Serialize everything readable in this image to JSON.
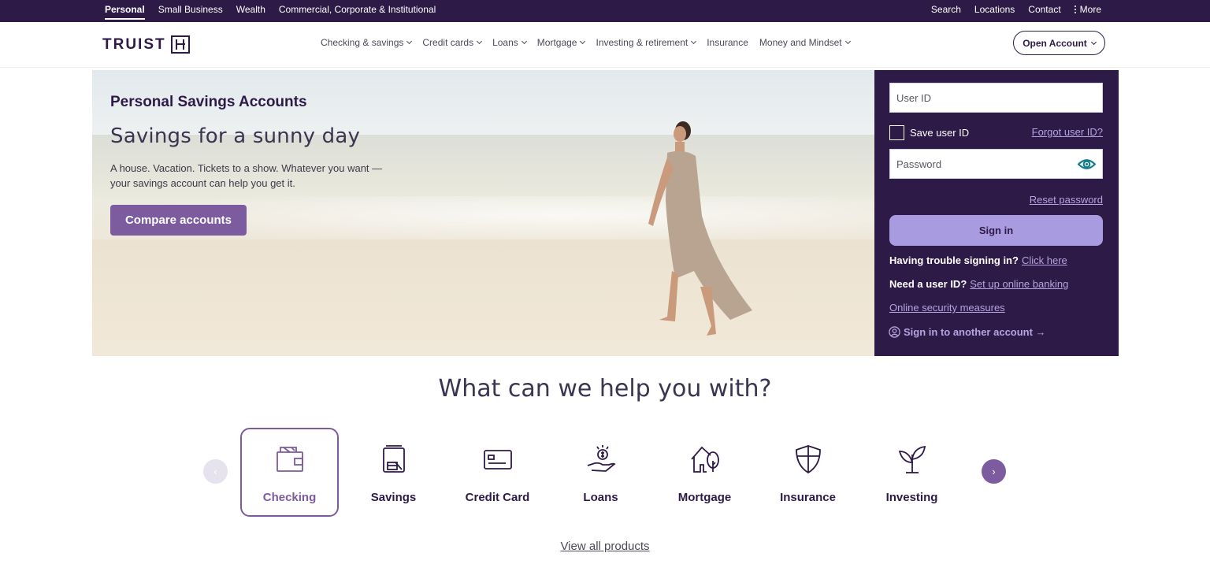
{
  "utility_nav": {
    "left": [
      "Personal",
      "Small Business",
      "Wealth",
      "Commercial, Corporate & Institutional"
    ],
    "right": {
      "search": "Search",
      "locations": "Locations",
      "contact": "Contact",
      "more": "More"
    }
  },
  "header": {
    "logo_text": "TRUIST",
    "nav": [
      "Checking & savings",
      "Credit cards",
      "Loans",
      "Mortgage",
      "Investing & retirement",
      "Insurance",
      "Money and Mindset"
    ],
    "open_account": "Open Account"
  },
  "hero": {
    "eyebrow": "Personal Savings Accounts",
    "title": "Savings for a sunny day",
    "body": "A house. Vacation. Tickets to a show. Whatever you want —your savings account can help you get it.",
    "cta": "Compare accounts"
  },
  "login": {
    "user_id_placeholder": "User ID",
    "save_user_id": "Save user ID",
    "forgot_user_id": "Forgot user ID?",
    "password_placeholder": "Password",
    "reset_password": "Reset password",
    "sign_in": "Sign in",
    "trouble_label": "Having trouble signing in?",
    "trouble_link": "Click here",
    "need_id_label": "Need a user ID?",
    "need_id_link": "Set up online banking",
    "security_link": "Online security measures",
    "another_account": "Sign in to another account →"
  },
  "help": {
    "title": "What can we help you with?",
    "prev_arrow": "‹",
    "next_arrow": "›",
    "products": [
      {
        "label": "Checking",
        "icon": "wallet-icon"
      },
      {
        "label": "Savings",
        "icon": "savings-jar-icon"
      },
      {
        "label": "Credit Card",
        "icon": "credit-card-icon"
      },
      {
        "label": "Loans",
        "icon": "hand-dollar-icon"
      },
      {
        "label": "Mortgage",
        "icon": "house-tree-icon"
      },
      {
        "label": "Insurance",
        "icon": "shield-icon"
      },
      {
        "label": "Investing",
        "icon": "sprout-icon"
      }
    ],
    "view_all": "View all products"
  },
  "colors": {
    "brand_purple": "#2e1a47",
    "accent_purple": "#7c5b9e",
    "link_lavender": "#b5a4e0",
    "signin_button": "#a99be0"
  }
}
